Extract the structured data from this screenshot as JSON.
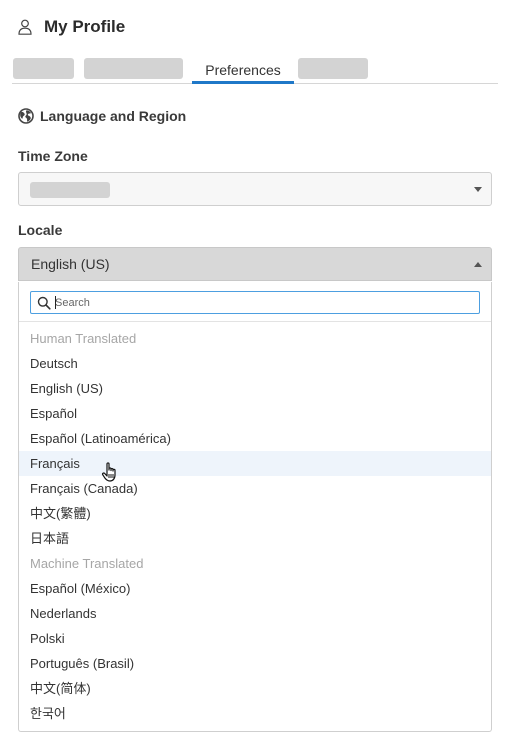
{
  "header": {
    "title": "My Profile",
    "icon": "user-icon"
  },
  "tabs": [
    {
      "label": "",
      "redacted": true
    },
    {
      "label": "",
      "redacted": true
    },
    {
      "label": "Preferences",
      "active": true
    },
    {
      "label": "",
      "redacted": true
    }
  ],
  "section": {
    "title": "Language and Region",
    "icon": "globe-icon"
  },
  "time_zone": {
    "label": "Time Zone",
    "value": "",
    "redacted": true
  },
  "locale": {
    "label": "Locale",
    "value": "English (US)",
    "open": true,
    "search_placeholder": "Search",
    "options": [
      {
        "label": "Human Translated",
        "type": "group"
      },
      {
        "label": "Deutsch",
        "type": "option"
      },
      {
        "label": "English (US)",
        "type": "option"
      },
      {
        "label": "Español",
        "type": "option"
      },
      {
        "label": "Español (Latinoamérica)",
        "type": "option"
      },
      {
        "label": "Français",
        "type": "option",
        "hovered": true
      },
      {
        "label": "Français (Canada)",
        "type": "option"
      },
      {
        "label": "中文(繁體)",
        "type": "option"
      },
      {
        "label": "日本語",
        "type": "option"
      },
      {
        "label": "Machine Translated",
        "type": "group"
      },
      {
        "label": "Español (México)",
        "type": "option"
      },
      {
        "label": "Nederlands",
        "type": "option"
      },
      {
        "label": "Polski",
        "type": "option"
      },
      {
        "label": "Português (Brasil)",
        "type": "option"
      },
      {
        "label": "中文(简体)",
        "type": "option"
      },
      {
        "label": "한국어",
        "type": "option"
      }
    ]
  },
  "colors": {
    "accent": "#1f78c8",
    "focus_border": "#4d9fe0",
    "hover_bg": "#eef4fb",
    "group_text": "#a6a6a6"
  }
}
